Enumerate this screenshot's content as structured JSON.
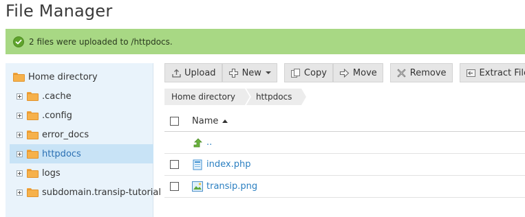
{
  "page": {
    "title": "File Manager"
  },
  "notice": {
    "text": "2 files were uploaded to /httpdocs.",
    "color": "#a8d884"
  },
  "sidebar": {
    "root": {
      "label": "Home directory",
      "icon": "folder-icon"
    },
    "items": [
      {
        "label": ".cache",
        "selected": false
      },
      {
        "label": ".config",
        "selected": false
      },
      {
        "label": "error_docs",
        "selected": false
      },
      {
        "label": "httpdocs",
        "selected": true
      },
      {
        "label": "logs",
        "selected": false
      },
      {
        "label": "subdomain.transip-tutorial",
        "selected": false
      }
    ]
  },
  "toolbar": {
    "upload": {
      "label": "Upload",
      "icon": "upload-icon"
    },
    "new": {
      "label": "New",
      "icon": "plus-icon"
    },
    "copy": {
      "label": "Copy",
      "icon": "copy-icon"
    },
    "move": {
      "label": "Move",
      "icon": "move-arrow-icon"
    },
    "remove": {
      "label": "Remove",
      "icon": "remove-x-icon"
    },
    "extract": {
      "label": "Extract Files",
      "icon": "extract-icon"
    }
  },
  "breadcrumb": [
    "Home directory",
    "httpdocs"
  ],
  "filelist": {
    "header": {
      "name": "Name",
      "sort": "ascending"
    },
    "rows": [
      {
        "name": "..",
        "type": "parent",
        "icon": "up-arrow-icon",
        "checkbox": false
      },
      {
        "name": "index.php",
        "type": "file",
        "icon": "php-file-icon",
        "checkbox": true
      },
      {
        "name": "transip.png",
        "type": "image",
        "icon": "image-file-icon",
        "checkbox": true
      }
    ]
  },
  "colors": {
    "accent_link": "#2a7fc1",
    "selected_bg": "#c8e3f6",
    "sidebar_bg": "#e9f3fb",
    "folder": "#f6b14b"
  }
}
